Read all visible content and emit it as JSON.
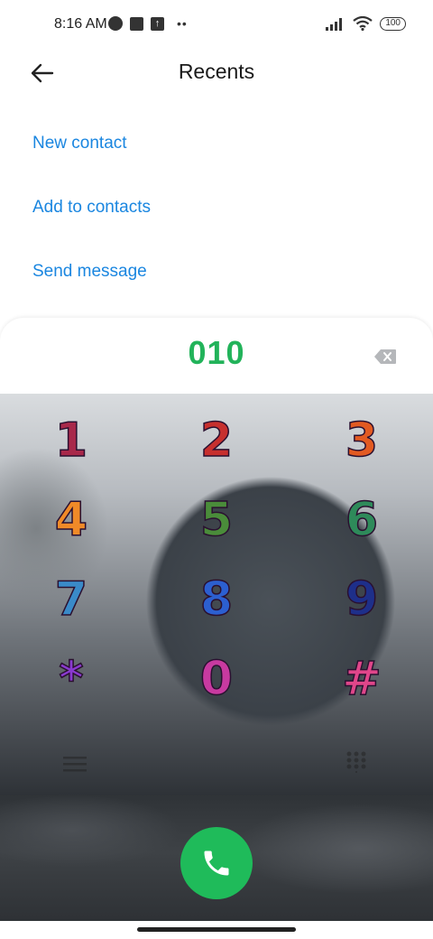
{
  "status_bar": {
    "time": "8:16 AM",
    "battery": "100"
  },
  "header": {
    "title": "Recents",
    "back_icon": "arrow-left-icon"
  },
  "actions": [
    {
      "label": "New contact"
    },
    {
      "label": "Add to contacts"
    },
    {
      "label": "Send message"
    }
  ],
  "dialer": {
    "number": "010",
    "keys": [
      "1",
      "2",
      "3",
      "4",
      "5",
      "6",
      "7",
      "8",
      "9",
      "*",
      "0",
      "#"
    ],
    "number_color": "#22b35a",
    "call_button_color": "#1fbb5a",
    "link_color": "#1a86e0"
  }
}
